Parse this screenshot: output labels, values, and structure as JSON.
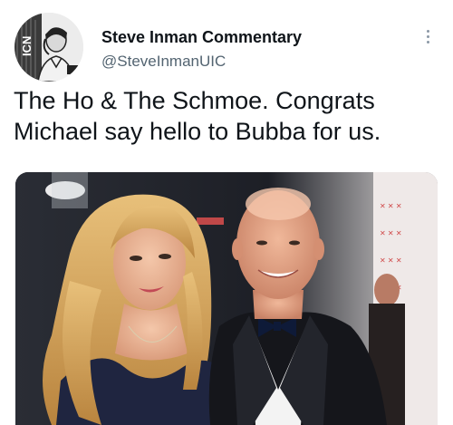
{
  "user": {
    "display_name": "Steve Inman Commentary",
    "handle": "@SteveInmanUIC",
    "avatar_icon": "cartoon-portrait-avatar"
  },
  "tweet": {
    "text": "The Ho & The Schmoe. Congrats\nMichael say hello to Bubba for us."
  },
  "media": {
    "kind": "photo",
    "description_icon": "red-carpet-photo"
  },
  "icons": {
    "more_options": "more-dots-icon"
  },
  "colors": {
    "text_primary": "#0f1419",
    "text_secondary": "#536471",
    "icon_grey": "#8b98a5"
  }
}
